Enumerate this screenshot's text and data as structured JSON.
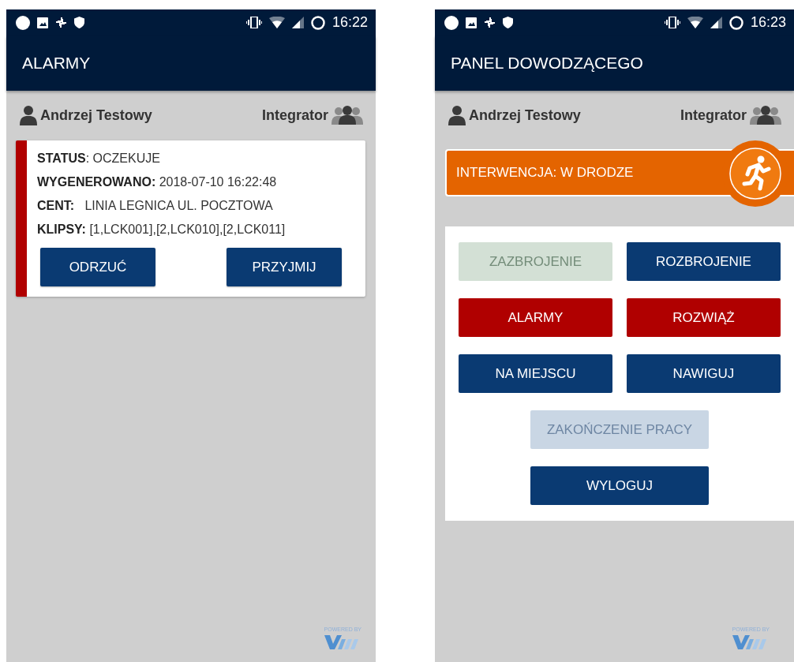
{
  "screens": [
    {
      "kind": "alarms",
      "status_bar": {
        "time": "16:22"
      },
      "title": "ALARMY",
      "user": {
        "name": "Andrzej Testowy",
        "role": "Integrator"
      },
      "alarm": {
        "lines": [
          "**STATUS**: OCZEKUJE",
          "**WYGENEROWANO:** 2018-07-10 16:22:48",
          "**CENT:**   LINIA LEGNICA UL. POCZTOWA",
          "**KLIPSY:** [1,LCK001],[2,LCK010],[2,LCK011]"
        ],
        "actions": [
          "ODRZUĆ",
          "PRZYJMIJ"
        ]
      },
      "powered_by": "POWERED BY"
    },
    {
      "kind": "panel",
      "status_bar": {
        "time": "16:23"
      },
      "title": "PANEL DOWODZĄCEGO",
      "user": {
        "name": "Andrzej Testowy",
        "role": "Integrator"
      },
      "intervention": {
        "label": "INTERWENCJA: W DRODZE"
      },
      "rows": [
        {
          "buttons": [
            {
              "label": "ZAZBROJENIE",
              "kind": "success",
              "disabled": true
            },
            {
              "label": "ROZBROJENIE",
              "kind": "primary",
              "disabled": false
            }
          ]
        },
        {
          "buttons": [
            {
              "label": "ALARMY",
              "kind": "danger",
              "disabled": false
            },
            {
              "label": "ROZWIĄŻ",
              "kind": "danger",
              "disabled": false
            }
          ]
        },
        {
          "buttons": [
            {
              "label": "NA MIEJSCU",
              "kind": "primary",
              "disabled": false
            },
            {
              "label": "NAWIGUJ",
              "kind": "primary",
              "disabled": false
            }
          ]
        },
        {
          "buttons": [
            {
              "label": "ZAKOŃCZENIE PRACY",
              "kind": "primary",
              "disabled": true
            }
          ]
        },
        {
          "buttons": [
            {
              "label": "WYLOGUJ",
              "kind": "primary",
              "disabled": false
            }
          ]
        }
      ],
      "powered_by": "POWERED BY"
    }
  ]
}
